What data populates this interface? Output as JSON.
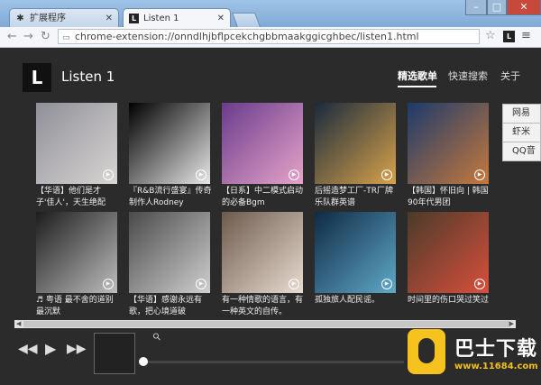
{
  "browser": {
    "tabs": [
      {
        "label": "扩展程序",
        "icon": "puzzle-icon"
      },
      {
        "label": "Listen 1",
        "icon": "listen1-icon"
      }
    ],
    "url": "chrome-extension://onndlhjbflpcekchgbbmaakggicghbec/listen1.html",
    "win_min": "–",
    "win_max": "□",
    "win_close": "✕"
  },
  "app": {
    "title": "Listen 1",
    "logo": "L",
    "nav": [
      "精选歌单",
      "快速搜索",
      "关于"
    ],
    "sources": [
      "网易",
      "虾米",
      "QQ音"
    ],
    "playlists": [
      {
        "title": "【华语】他们是才子'佳人'，天生绝配",
        "colors": [
          "#8f8f98",
          "#d8d5d2"
        ]
      },
      {
        "title": "『R&B流行盛宴』传奇制作人Rodney Jerkins",
        "colors": [
          "#000000",
          "#e8e8e8"
        ]
      },
      {
        "title": "【日系】中二模式启动的必备Bgm",
        "colors": [
          "#6a3c8c",
          "#e6a3c9"
        ]
      },
      {
        "title": "后摇造梦工厂-TR厂牌乐队群英谱",
        "colors": [
          "#1a2a3d",
          "#d8a24a"
        ]
      },
      {
        "title": "【韩国】怀旧向 | 韩国90年代男团",
        "colors": [
          "#1b3a6b",
          "#c7793c"
        ]
      },
      {
        "title": "♬ 粤语 最不舍的道别最沉默",
        "colors": [
          "#1d1d1d",
          "#bdbdbd"
        ]
      },
      {
        "title": "【华语】感谢永远有歌，把心境道破",
        "colors": [
          "#4a4a4a",
          "#cfcfcf"
        ]
      },
      {
        "title": "有一种情歌的语言，有一种英文的自传。",
        "colors": [
          "#6d5a4d",
          "#e9dcd1"
        ]
      },
      {
        "title": "孤独旅人配民谣。",
        "colors": [
          "#0f2a44",
          "#5fa9c9"
        ]
      },
      {
        "title": "时间里的伤口哭过笑过",
        "colors": [
          "#4a3b2a",
          "#d94f3b"
        ]
      }
    ]
  },
  "player": {
    "prev": "◀◀",
    "play": "▶",
    "next": "▶▶",
    "link_icon": "⚲",
    "progress": 0
  },
  "watermark": {
    "brand": "巴士下载",
    "url": "www.11684.com"
  }
}
